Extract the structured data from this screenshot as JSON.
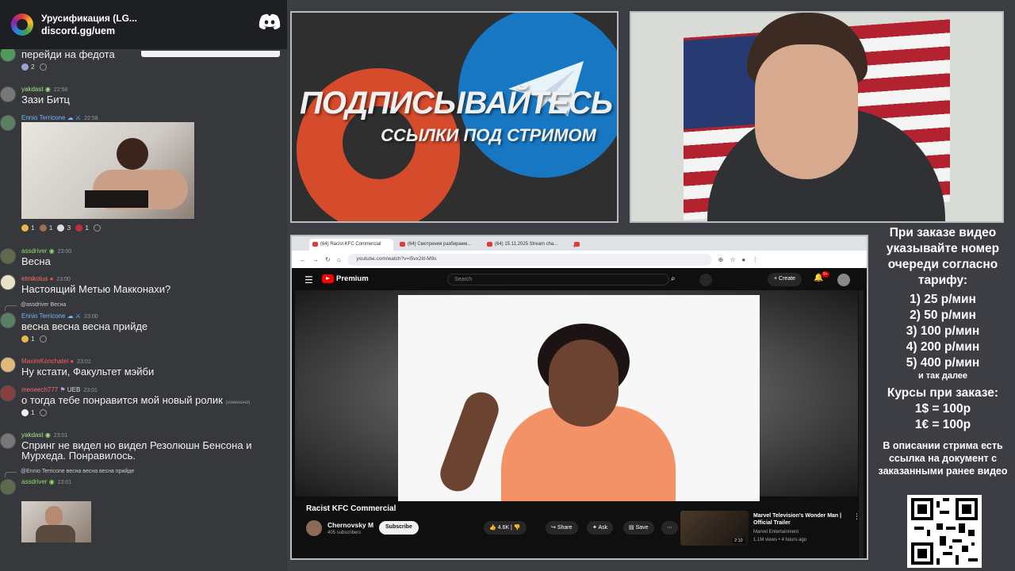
{
  "discord": {
    "server_name": "Урусификация (LG...",
    "invite": "discord.gg/uem",
    "messages": [
      {
        "text": "перейди на федота",
        "reactions": [
          "2",
          ""
        ]
      },
      {
        "user": "yakdast",
        "time": "22:58",
        "text": "Зази Битц"
      },
      {
        "user": "Ennio Terricone",
        "time": "22:58",
        "reactions": [
          "1",
          "1",
          "3",
          "1",
          ""
        ]
      },
      {
        "user": "assdriver",
        "time": "23:00",
        "text": "Весна"
      },
      {
        "user": "elmikolus",
        "time": "23:00",
        "text": "Настоящий Метью Макконахи?"
      },
      {
        "reply": "@assdriver Весна",
        "user": "Ennio Terricone",
        "time": "23:00",
        "text": "весна весна весна прийде",
        "reactions": [
          "1",
          ""
        ]
      },
      {
        "user": "MaximKonchatel",
        "time": "23:01",
        "text": "Ну кстати, Факультет мэйби"
      },
      {
        "user": "meneech777",
        "badge": "UEB",
        "time": "23:01",
        "text": "о тогда тебе понравится мой новый ролик",
        "edited": "(изменено)",
        "reactions": [
          "1",
          ""
        ]
      },
      {
        "user": "yakdast",
        "time": "23:01",
        "text": "Спринг не видел но видел Резолюшн Бенсона и",
        "text2": "Мурхеда. Понравилось."
      },
      {
        "reply": "@Ennio Terricone весна весна весна прийде",
        "user": "assdriver",
        "time": "23:01"
      }
    ]
  },
  "promo": {
    "line1": "ПОДПИСЫВАЙТЕСЬ",
    "line2": "ССЫЛКИ ПОД СТРИМОМ"
  },
  "info": {
    "intro": "При заказе видео указывайте номер очереди согласно тарифу:",
    "tariffs": [
      "1) 25 р/мин",
      "2) 50 р/мин",
      "3) 100 р/мин",
      "4) 200 р/мин",
      "5) 400 р/мин"
    ],
    "etc": "и так далее",
    "rates_title": "Курсы при заказе:",
    "rates": [
      "1$ = 100р",
      "1€ = 100р"
    ],
    "footer": "В описании стрима есть ссылка на документ с заказанными ранее видео"
  },
  "browser": {
    "tabs": [
      "(64) Racist KFC Commercial",
      "(64) Смотрения разбираем...",
      "(64) 15.11.2025 Stream cha..."
    ],
    "url": "youtube.com/watch?v=l5vx2itl-M9s"
  },
  "youtube": {
    "logo": "Premium",
    "search_placeholder": "Search",
    "create": "Create",
    "notif_count": "9+",
    "video_title": "Racist KFC Commercial",
    "channel": "Chernovsky M",
    "subscribers": "405 subscribers",
    "subscribe": "Subscribe",
    "likes": "4.6K",
    "share": "Share",
    "ask": "Ask",
    "save": "Save",
    "rec_title": "Marvel Television's Wonder Man | Official Trailer",
    "rec_channel": "Marvel Entertainment",
    "rec_meta": "1.1M views • 4 hours ago",
    "rec_duration": "2:10"
  },
  "colors": {
    "discord_bg": "#36383c",
    "yt_red": "#ff0000",
    "promo_orange": "#d64b2b",
    "promo_blue": "#1877c2"
  }
}
